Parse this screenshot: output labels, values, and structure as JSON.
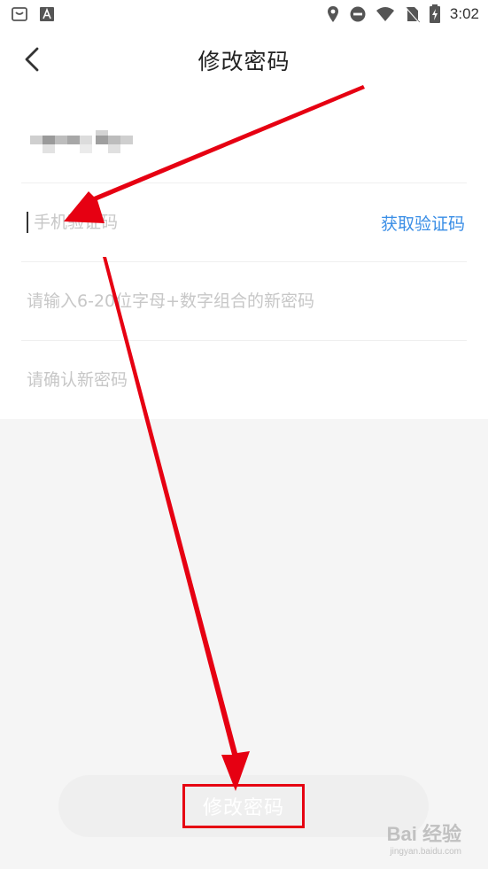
{
  "status_bar": {
    "time": "3:02",
    "left_icons": [
      "shopping-bag-icon",
      "text-a-icon"
    ],
    "right_icons": [
      "location-icon",
      "do-not-disturb-icon",
      "wifi-icon",
      "no-sim-icon",
      "battery-charging-icon"
    ]
  },
  "app_bar": {
    "title": "修改密码",
    "back_icon": "chevron-left-icon"
  },
  "form": {
    "masked_phone_icon": "masked-phone-number",
    "code_placeholder": "手机验证码",
    "get_code_label": "获取验证码",
    "new_password_placeholder": "请输入6-20位字母+数字组合的新密码",
    "confirm_password_placeholder": "请确认新密码"
  },
  "submit": {
    "label": "修改密码"
  },
  "watermark": {
    "main": "Bai 经验",
    "sub": "jingyan.baidu.com"
  },
  "colors": {
    "accent_blue": "#3a8ee6",
    "annotation_red": "#e60012",
    "background": "#f5f5f5",
    "placeholder": "#c7c7c7"
  }
}
